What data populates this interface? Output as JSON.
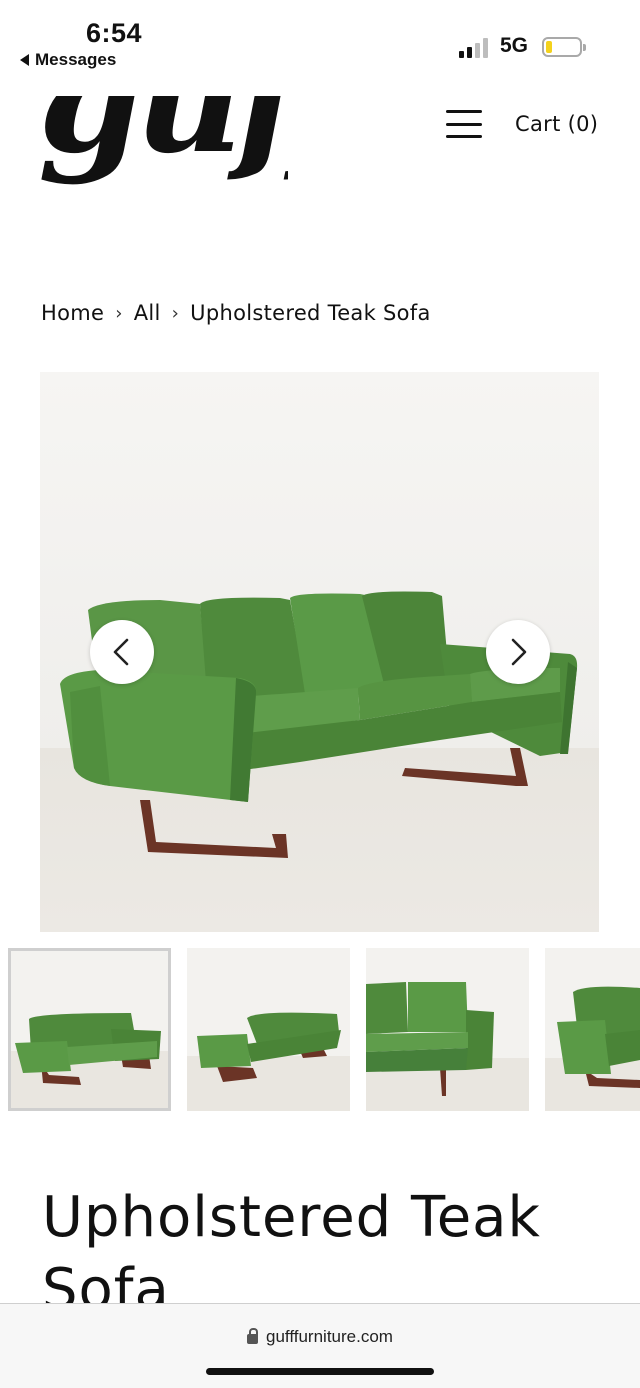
{
  "status_bar": {
    "time": "6:54",
    "back_label": "Messages",
    "network": "5G"
  },
  "header": {
    "logo_text": "guff",
    "menu_icon": "hamburger-menu-icon",
    "cart_label": "Cart (0)"
  },
  "breadcrumb": {
    "items": [
      "Home",
      "All",
      "Upholstered Teak Sofa"
    ],
    "separator": "›"
  },
  "gallery": {
    "prev_icon": "chevron-left-icon",
    "next_icon": "chevron-right-icon",
    "sofa_color": "#4f8a3c",
    "wood_color": "#6b3426"
  },
  "product": {
    "title": "Upholstered Teak Sofa"
  },
  "browser": {
    "url": "gufffurniture.com",
    "lock_icon": "lock-icon"
  }
}
